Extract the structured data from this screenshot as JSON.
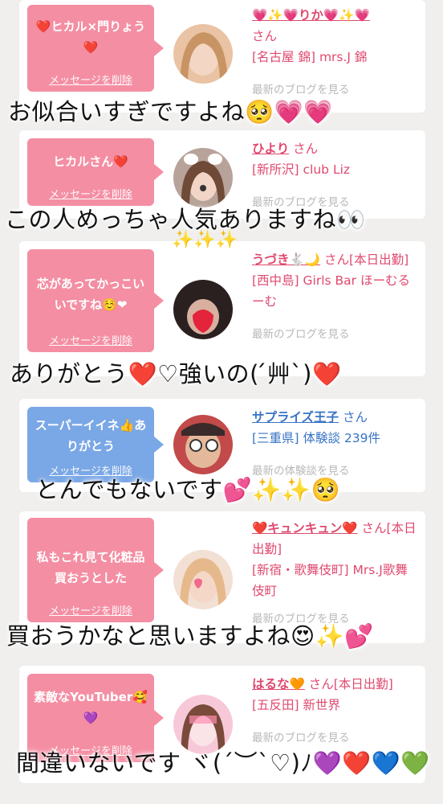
{
  "cards": [
    {
      "message": "❤️ヒカル×門りょう❤️",
      "delete": "メッセージを削除",
      "name": "💗✨💗りか💗✨💗",
      "suffix": "さん",
      "line1": "[名古屋 錦] mrs.J 錦",
      "more": "最新のブログを見る"
    },
    {
      "message": "ヒカルさん❤️",
      "delete": "メッセージを削除",
      "name": "ひより",
      "suffix": "さん",
      "line1": "[新所沢] club Liz",
      "more": "最新のブログを見る"
    },
    {
      "message": "芯があってかっこいいですね☺️❤",
      "delete": "メッセージを削除",
      "name": "うづき🐇🌙",
      "suffix": "さん[本日出勤]",
      "line1": "[西中島] Girls Bar ほーむるーむ",
      "more": "最新のブログを見る"
    },
    {
      "message": "スーパーイイネ👍ありがとう",
      "delete": "メッセージを削除",
      "name": "サプライズ王子",
      "suffix": "さん",
      "line1": "[三重県] 体験談 239件",
      "more": "最新の体験談を見る"
    },
    {
      "message": "私もこれ見て化粧品買おうとした",
      "delete": "メッセージを削除",
      "name": "❤️キュンキュン❤️",
      "suffix": "さん[本日出勤]",
      "line1": "[新宿・歌舞伎町] Mrs.J歌舞伎町",
      "more": "最新のブログを見る"
    },
    {
      "message": "素敵なYouTuber🥰💜",
      "delete": "メッセージを削除",
      "name": "はるな🧡",
      "suffix": "さん[本日出勤]",
      "line1": "[五反田] 新世界",
      "more": "最新のブログを見る"
    }
  ],
  "captions": [
    "お似合いすぎですよね🥺💗💗",
    "この人めっちゃ人気ありますね👀",
    "ありがとう❤️♡強いの( ́艸`)❤️",
    "とんでもないです💕✨✨🥺",
    "買おうかなと思いますよね😍✨💕",
    "間違いないです ヾ(´︶`♡)ﾉ💜❤️💙💚"
  ],
  "colors": {
    "background": "#f0efee",
    "bubble_pink": "#f48ea3",
    "bubble_blue": "#7aa7e6",
    "name_pink": "#e0496f",
    "name_blue": "#3873c6"
  }
}
